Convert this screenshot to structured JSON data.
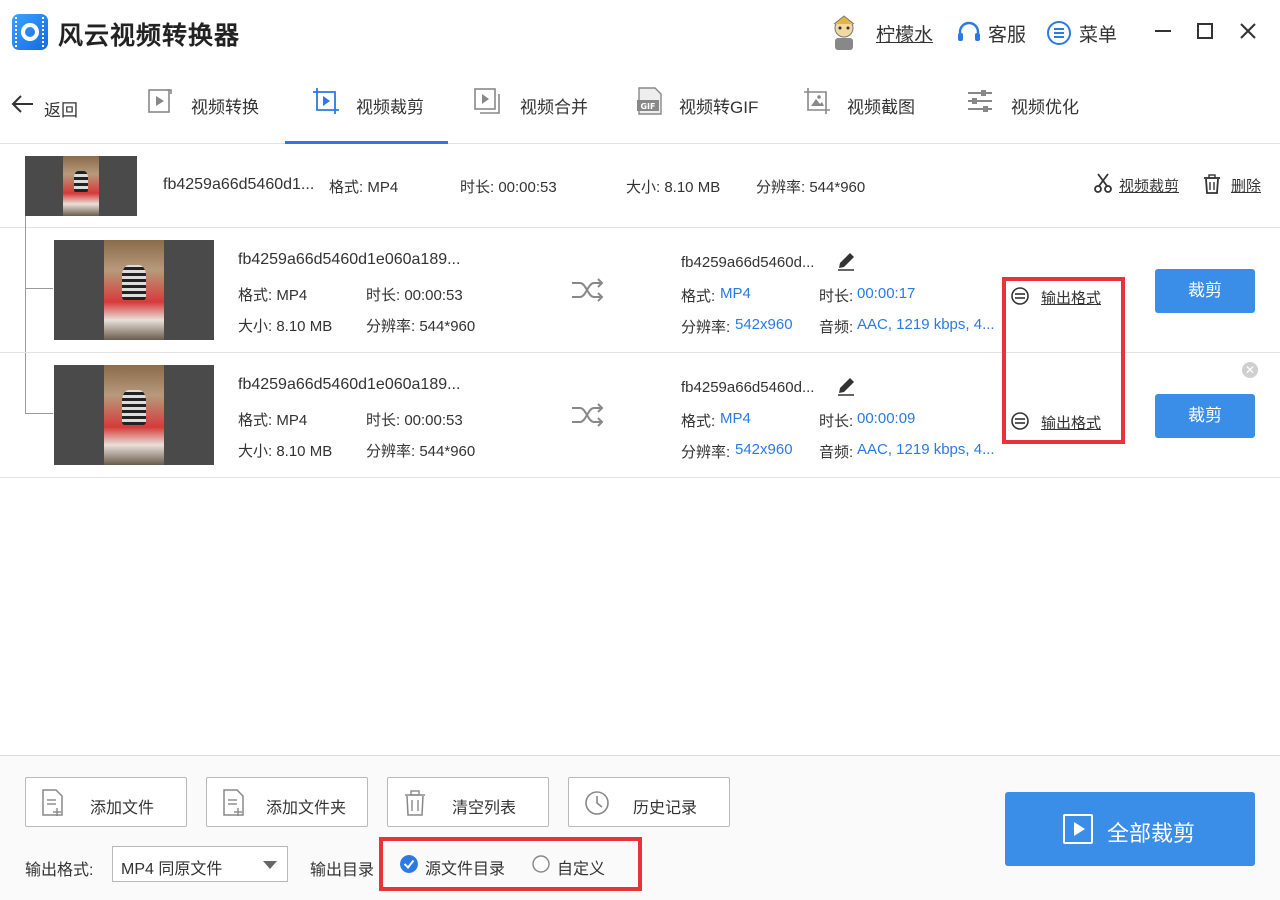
{
  "app": {
    "title": "风云视频转换器"
  },
  "header": {
    "user_name": "柠檬水",
    "service_label": "客服",
    "menu_label": "菜单"
  },
  "nav": {
    "back_label": "返回",
    "tabs": [
      {
        "label": "视频转换",
        "icon": "video-convert-icon"
      },
      {
        "label": "视频裁剪",
        "icon": "video-crop-icon",
        "active": true
      },
      {
        "label": "视频合并",
        "icon": "video-merge-icon"
      },
      {
        "label": "视频转GIF",
        "icon": "gif-icon"
      },
      {
        "label": "视频截图",
        "icon": "screenshot-icon"
      },
      {
        "label": "视频优化",
        "icon": "optimize-icon"
      }
    ]
  },
  "source": {
    "filename": "fb4259a66d5460d1...",
    "format": "格式: MP4",
    "duration": "时长: 00:00:53",
    "size": "大小: 8.10 MB",
    "resolution": "分辨率: 544*960",
    "crop_action": "视频裁剪",
    "delete_action": "删除"
  },
  "clips": [
    {
      "in_name": "fb4259a66d5460d1e060a189...",
      "in_format": "格式: MP4",
      "in_duration": "时长: 00:00:53",
      "in_size": "大小: 8.10 MB",
      "in_resolution": "分辨率: 544*960",
      "out_name": "fb4259a66d5460d...",
      "out_format_label": "格式:",
      "out_format": "MP4",
      "out_duration_label": "时长:",
      "out_duration": "00:00:17",
      "out_resolution_label": "分辨率:",
      "out_resolution": "542x960",
      "out_audio_label": "音频:",
      "out_audio": "AAC, 1219 kbps, 4...",
      "output_format_link": "输出格式",
      "cut_label": "裁剪"
    },
    {
      "in_name": "fb4259a66d5460d1e060a189...",
      "in_format": "格式: MP4",
      "in_duration": "时长: 00:00:53",
      "in_size": "大小: 8.10 MB",
      "in_resolution": "分辨率: 544*960",
      "out_name": "fb4259a66d5460d...",
      "out_format_label": "格式:",
      "out_format": "MP4",
      "out_duration_label": "时长:",
      "out_duration": "00:00:09",
      "out_resolution_label": "分辨率:",
      "out_resolution": "542x960",
      "out_audio_label": "音频:",
      "out_audio": "AAC, 1219 kbps, 4...",
      "output_format_link": "输出格式",
      "cut_label": "裁剪"
    }
  ],
  "bottom": {
    "add_file": "添加文件",
    "add_folder": "添加文件夹",
    "clear_list": "清空列表",
    "history": "历史记录",
    "output_format_label": "输出格式:",
    "output_format_value": "MP4 同原文件",
    "output_dir_label": "输出目录",
    "dir_option_source": "源文件目录",
    "dir_option_custom": "自定义",
    "dir_selected": "源文件目录",
    "crop_all": "全部裁剪"
  },
  "colors": {
    "accent": "#3a8ee8",
    "highlight": "#e8333a",
    "link_value": "#2a7ae2"
  }
}
